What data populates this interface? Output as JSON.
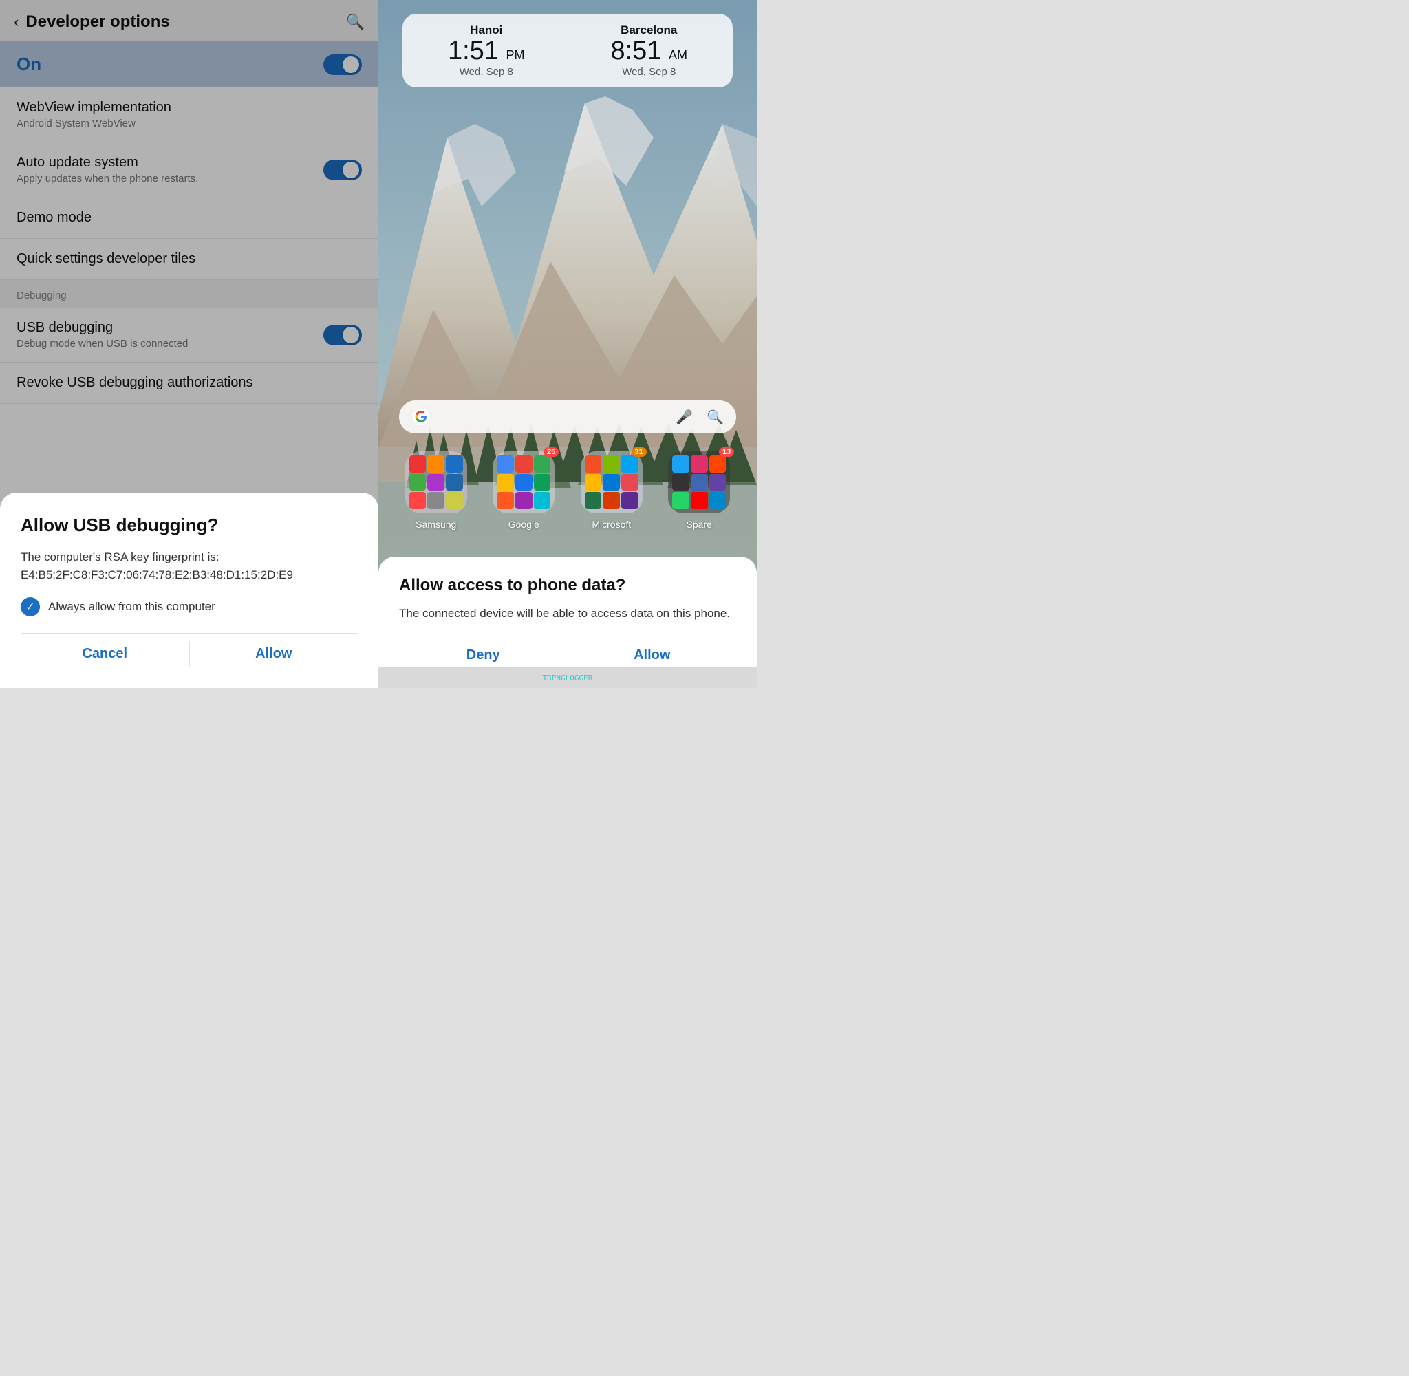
{
  "left": {
    "header": {
      "back_label": "‹",
      "title": "Developer options",
      "search_icon": "🔍"
    },
    "on_row": {
      "label": "On"
    },
    "settings": [
      {
        "title": "WebView implementation",
        "subtitle": "Android System WebView",
        "has_toggle": false
      },
      {
        "title": "Auto update system",
        "subtitle": "Apply updates when the phone restarts.",
        "has_toggle": true
      },
      {
        "title": "Demo mode",
        "subtitle": "",
        "has_toggle": false
      },
      {
        "title": "Quick settings developer tiles",
        "subtitle": "",
        "has_toggle": false
      }
    ],
    "section_header": "Debugging",
    "debug_items": [
      {
        "title": "USB debugging",
        "subtitle": "Debug mode when USB is connected",
        "has_toggle": true
      },
      {
        "title": "Revoke USB debugging authorizations",
        "subtitle": "",
        "has_toggle": false
      }
    ],
    "modal": {
      "title": "Allow USB debugging?",
      "body": "The computer's RSA key fingerprint is:\nE4:B5:2F:C8:F3:C7:06:74:78:E2:B3:48:D1:15:2D:E9",
      "checkbox_label": "Always allow from this computer",
      "cancel_btn": "Cancel",
      "allow_btn": "Allow"
    }
  },
  "right": {
    "clock_widget": {
      "city1": "Hanoi",
      "time1": "1:51",
      "ampm1": "PM",
      "date1": "Wed, Sep 8",
      "city2": "Barcelona",
      "time2": "8:51",
      "ampm2": "AM",
      "date2": "Wed, Sep 8"
    },
    "apps": [
      {
        "label": "Samsung",
        "badge": "",
        "badge_num": ""
      },
      {
        "label": "Google",
        "badge": "25",
        "badge_num": "25"
      },
      {
        "label": "Microsoft",
        "badge": "31",
        "badge_num": "31"
      },
      {
        "label": "Spare",
        "badge": "13",
        "badge_num": "13"
      }
    ],
    "modal": {
      "title": "Allow access to phone data?",
      "body": "The connected device will be able to access data on this phone.",
      "deny_btn": "Deny",
      "allow_btn": "Allow"
    },
    "bottom_watermark": "TRPNGLOGGER"
  }
}
